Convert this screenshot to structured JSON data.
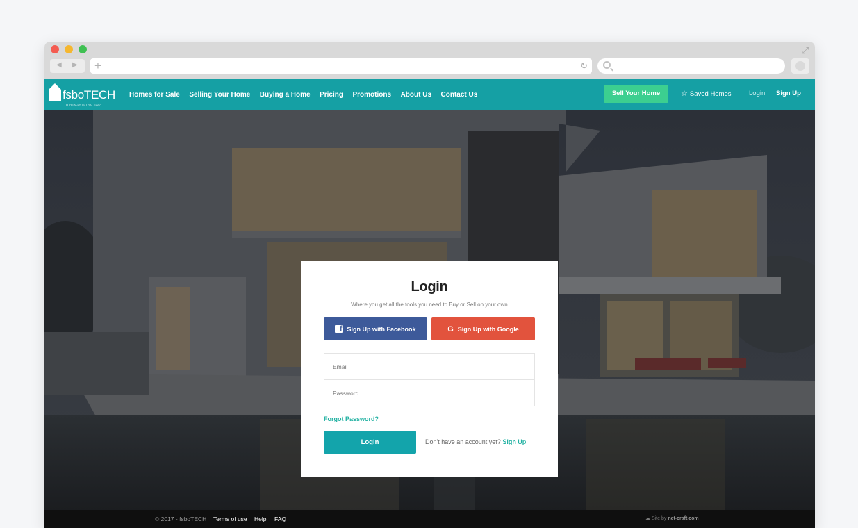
{
  "nav": {
    "brand": "fsboTECH",
    "tagline": "IT REALLY IS THAT EASY",
    "menu": [
      "Homes for Sale",
      "Selling Your Home",
      "Buying a Home",
      "Pricing",
      "Promotions",
      "About Us",
      "Contact Us"
    ],
    "sell_label": "Sell Your Home",
    "saved_label": "Saved Homes",
    "login_label": "Login",
    "signup_label": "Sign Up"
  },
  "login": {
    "title": "Login",
    "subtitle": "Where you get all the tools you need to Buy or Sell on your own",
    "facebook_label": "Sign Up with Facebook",
    "google_label": "Sign Up with Google",
    "email_placeholder": "Email",
    "password_placeholder": "Password",
    "forgot_label": "Forgot Password?",
    "button_label": "Login",
    "no_account_text": "Don't have an account yet?",
    "signup_link": "Sign Up"
  },
  "footer": {
    "copyright": "© 2017 - fsboTECH",
    "links": [
      "Terms of use",
      "Help",
      "FAQ"
    ],
    "credit_prefix": "Site by",
    "credit_name": "net-craft.com"
  },
  "colors": {
    "nav_bg": "#15a0a4",
    "sell_button": "#3ccf90",
    "facebook": "#3d5a9a",
    "google": "#e2533d",
    "login_button": "#13a4ab",
    "link_accent": "#21b1a2",
    "footer_bg": "#0f0f0f"
  },
  "icons": {
    "window_controls": [
      "close-dot",
      "minimize-dot",
      "maximize-dot"
    ],
    "browser": [
      "back-icon",
      "forward-icon",
      "plus-icon",
      "reload-icon",
      "search-icon",
      "expand-icon"
    ],
    "nav": [
      "house-logo-icon",
      "star-icon"
    ],
    "login": [
      "facebook-icon",
      "google-icon"
    ],
    "footer": [
      "netcraft-icon"
    ]
  }
}
